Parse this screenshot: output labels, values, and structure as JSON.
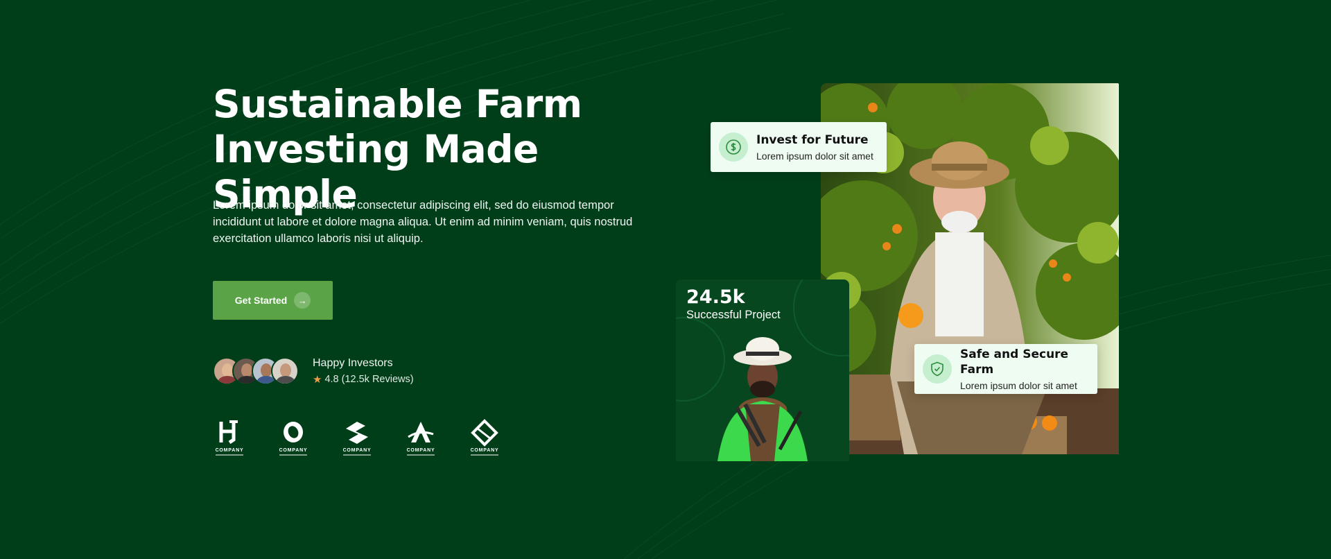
{
  "hero": {
    "title_line1": "Sustainable Farm",
    "title_line2": "Investing Made Simple",
    "description": "Lorem ipsum dolor sit amet, consectetur adipiscing elit, sed do eiusmod tempor incididunt ut labore et dolore magna aliqua. Ut enim ad minim veniam, quis nostrud exercitation ullamco laboris nisi ut aliquip.",
    "cta_label": "Get Started",
    "cta_icon": "arrow-right-icon"
  },
  "investors": {
    "title": "Happy Investors",
    "rating": "4.8",
    "reviews": "(12.5k Reviews)",
    "rating_icon": "star-icon",
    "avatars": [
      "avatar-1",
      "avatar-2",
      "avatar-3",
      "avatar-4"
    ]
  },
  "logos": [
    {
      "name": "company-logo-h",
      "word": "COMPANY"
    },
    {
      "name": "company-logo-o",
      "word": "COMPANY"
    },
    {
      "name": "company-logo-s",
      "word": "COMPANY"
    },
    {
      "name": "company-logo-a",
      "word": "COMPANY"
    },
    {
      "name": "company-logo-diamond",
      "word": "COMPANY"
    }
  ],
  "stat": {
    "value": "24.5k",
    "label": "Successful Project"
  },
  "cards": {
    "invest": {
      "title": "Invest for Future",
      "subtitle": "Lorem ipsum dolor sit amet",
      "icon": "dollar-icon"
    },
    "safe": {
      "title": "Safe and Secure Farm",
      "subtitle": "Lorem ipsum dolor sit amet",
      "icon": "shield-check-icon"
    }
  },
  "colors": {
    "background": "#003e1a",
    "accent": "#5aa447",
    "card_bg": "#eefcf2",
    "icon_circle": "#c5efcf",
    "star": "#f2994a"
  }
}
